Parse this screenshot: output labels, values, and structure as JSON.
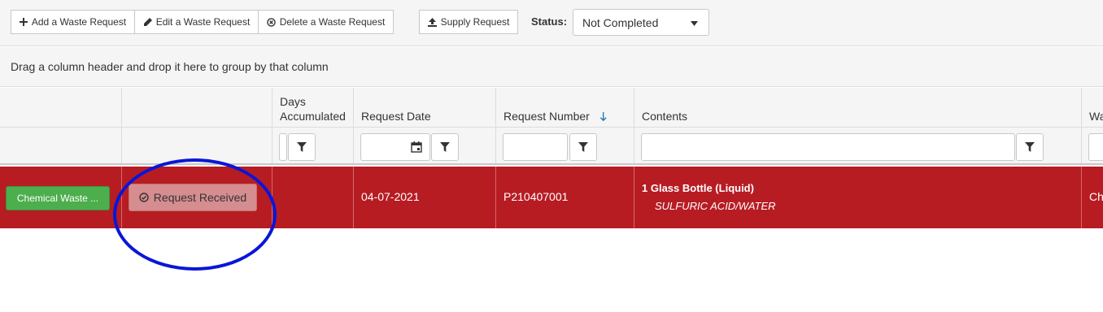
{
  "toolbar": {
    "add_label": "Add a Waste Request",
    "edit_label": "Edit a Waste Request",
    "delete_label": "Delete a Waste Request",
    "supply_label": "Supply Request",
    "status_label": "Status:",
    "status_value": "Not Completed"
  },
  "group_panel": {
    "hint": "Drag a column header and drop it here to group by that column"
  },
  "columns": {
    "days_line1": "Days",
    "days_line2": "Accumulated",
    "request_date": "Request Date",
    "request_number": "Request Number",
    "contents": "Contents",
    "waste_partial": "Wa"
  },
  "row": {
    "type_button": "Chemical Waste ...",
    "status_button": "Request Received",
    "request_date": "04-07-2021",
    "request_number": "P210407001",
    "contents_title": "1 Glass Bottle (Liquid)",
    "contents_detail": "SULFURIC ACID/WATER",
    "waste_partial": "Ch"
  },
  "colors": {
    "row_highlight": "#b71c23",
    "annotation": "#0a16d6",
    "success": "#4cae4c"
  }
}
